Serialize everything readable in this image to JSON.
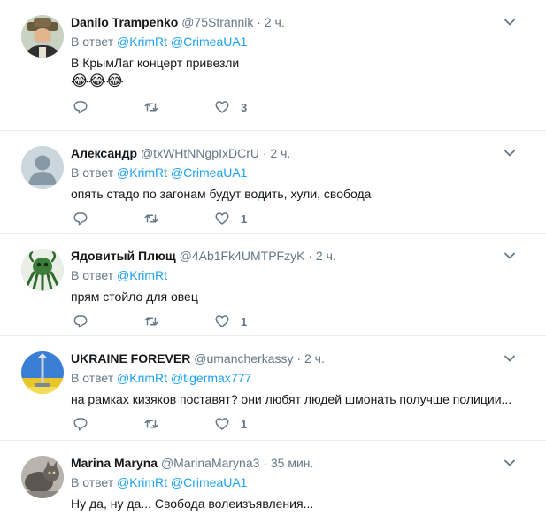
{
  "tweets": [
    {
      "name": "Danilo Trampenko",
      "handle": "@75Strannik",
      "time": "2 ч.",
      "reply_prefix": "В ответ",
      "mentions": [
        "@KrimRt",
        "@CrimeaUA1"
      ],
      "text": "В КрымЛаг концерт привезли",
      "emoji": "😂😂😂",
      "likes": "3",
      "avatar": "cossack-portrait"
    },
    {
      "name": "Александр",
      "handle": "@txWHtNNgpIxDCrU",
      "time": "2 ч.",
      "reply_prefix": "В ответ",
      "mentions": [
        "@KrimRt",
        "@CrimeaUA1"
      ],
      "text": "опять стадо по загонам будут водить, хули, свобода",
      "likes": "1",
      "avatar": "default-egg"
    },
    {
      "name": "Ядовитый Плющ",
      "handle": "@4Ab1Fk4UMTPFzyK",
      "time": "2 ч.",
      "reply_prefix": "В ответ",
      "mentions": [
        "@KrimRt"
      ],
      "text": "прям стойло для овец",
      "likes": "1",
      "avatar": "green-creature"
    },
    {
      "name": "UKRAINE FOREVER",
      "handle": "@umancherkassy",
      "time": "2 ч.",
      "reply_prefix": "В ответ",
      "mentions": [
        "@KrimRt",
        "@tigermax777"
      ],
      "text": "на рамках кизяков поставят? они любят людей шмонать получше полиции...",
      "likes": "1",
      "avatar": "monument-blue-yellow"
    },
    {
      "name": "Marina Maryna",
      "handle": "@MarinaMaryna3",
      "time": "35 мин.",
      "reply_prefix": "В ответ",
      "mentions": [
        "@KrimRt",
        "@CrimeaUA1"
      ],
      "text": "Ну да,  ну да... Свобода волеизъявления...",
      "avatar": "cat-photo"
    }
  ],
  "separator": "·",
  "colors": {
    "link": "#1da1f2",
    "muted": "#657786",
    "text": "#14171a",
    "border": "#e6ecf0"
  },
  "icons": {
    "reply": "reply-icon",
    "retweet": "retweet-icon",
    "like": "heart-icon",
    "menu": "chevron-down-icon"
  }
}
